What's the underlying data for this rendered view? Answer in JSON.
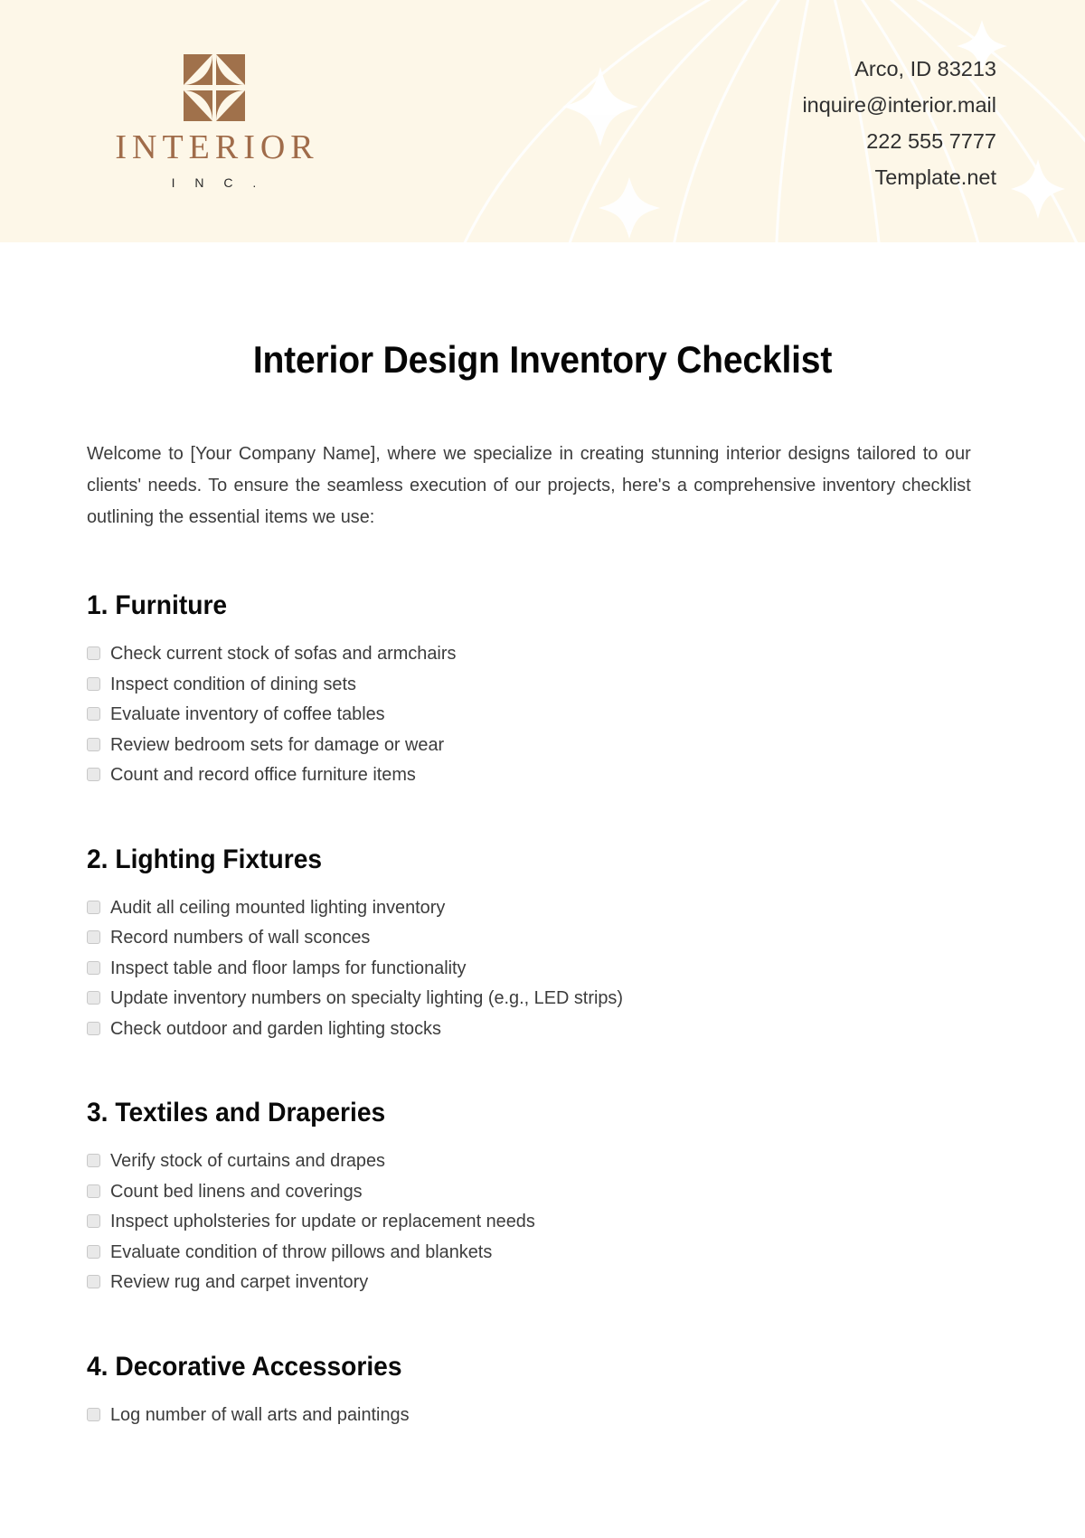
{
  "theme": {
    "header_bg": "#fdf7e8",
    "brand_brown": "#a06c4a",
    "text_dark": "#3c3c3c",
    "heading_black": "#0a0a0a",
    "checkbox_fill": "#e9e9e9",
    "checkbox_border": "#c8c8c8",
    "deco_line": "#ffffff"
  },
  "header": {
    "logo": {
      "mark_icon": "four-petal-square-logo-icon",
      "wordmark": "INTERIOR",
      "sub_wordmark": "I N C ."
    },
    "contact": [
      "Arco, ID 83213",
      "inquire@interior.mail",
      "222 555 7777",
      "Template.net"
    ]
  },
  "document": {
    "title": "Interior Design Inventory Checklist",
    "intro": "Welcome to [Your Company Name], where we specialize in creating stunning interior designs tailored to our clients' needs. To ensure the seamless execution of our projects, here's a comprehensive inventory checklist outlining the essential items we use:",
    "sections": [
      {
        "number": "1.",
        "heading": "Furniture",
        "title": "1. Furniture",
        "items": [
          "Check current stock of sofas and armchairs",
          "Inspect condition of dining sets",
          "Evaluate inventory of coffee tables",
          "Review bedroom sets for damage or wear",
          "Count and record office furniture items"
        ]
      },
      {
        "number": "2.",
        "heading": "Lighting Fixtures",
        "title": "2. Lighting Fixtures",
        "items": [
          "Audit all ceiling mounted lighting inventory",
          "Record numbers of wall sconces",
          "Inspect table and floor lamps for functionality",
          "Update inventory numbers on specialty lighting (e.g., LED strips)",
          "Check outdoor and garden lighting stocks"
        ]
      },
      {
        "number": "3.",
        "heading": "Textiles and Draperies",
        "title": "3. Textiles and Draperies",
        "items": [
          "Verify stock of curtains and drapes",
          "Count bed linens and coverings",
          "Inspect upholsteries for update or replacement needs",
          "Evaluate condition of throw pillows and blankets",
          "Review rug and carpet inventory"
        ]
      },
      {
        "number": "4.",
        "heading": "Decorative Accessories",
        "title": "4. Decorative Accessories",
        "items": [
          "Log number of wall arts and paintings"
        ]
      }
    ]
  }
}
